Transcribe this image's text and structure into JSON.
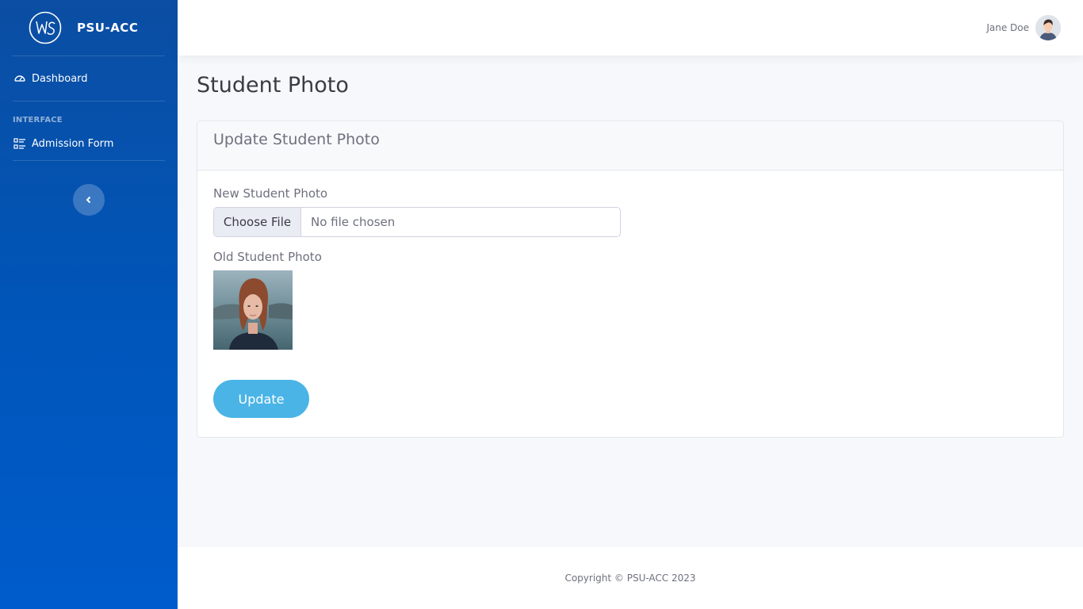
{
  "brand": {
    "name": "PSU-ACC",
    "logo_text": "WS"
  },
  "sidebar": {
    "dashboard_label": "Dashboard",
    "section_heading": "INTERFACE",
    "admission_label": "Admission Form",
    "toggle_icon": "chevron-left-icon"
  },
  "topbar": {
    "user_name": "Jane Doe"
  },
  "page": {
    "title": "Student Photo"
  },
  "card": {
    "header": "Update Student Photo",
    "new_photo_label": "New Student Photo",
    "file_button": "Choose File",
    "file_status": "No file chosen",
    "old_photo_label": "Old Student Photo",
    "update_button": "Update"
  },
  "footer": {
    "copyright": "Copyright © PSU-ACC 2023"
  },
  "colors": {
    "sidebar": "#0b4ea3",
    "accent": "#4ab4e6"
  }
}
